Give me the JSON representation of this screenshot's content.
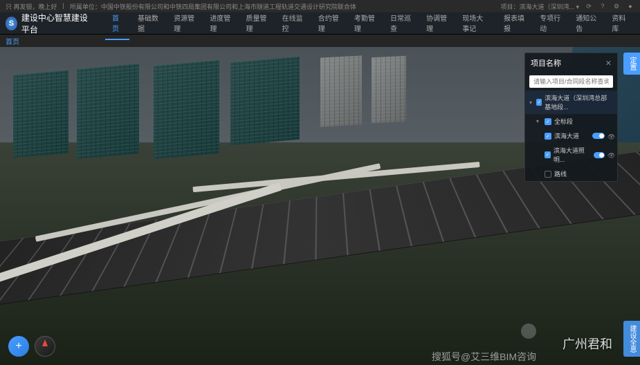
{
  "topBar": {
    "greeting": "只 再发银，晚上好",
    "org": "所属单位：中国中铁股份有限公司和中铁四局集团有限公司和上海市隧道工程轨道交通设计研究院联合体",
    "project": "项目：滨海大道（深圳湾...",
    "dropdown": "▾"
  },
  "app": {
    "logoText": "S",
    "title": "建设中心智慧建设平台"
  },
  "nav": {
    "items": [
      "首页",
      "基础数据",
      "资源管理",
      "进度管理",
      "质量管理",
      "在线监控",
      "合约管理",
      "考勤管理",
      "日常巡查",
      "协调管理",
      "现场大事记",
      "报表填报",
      "专项行动",
      "通知公告",
      "资料库"
    ],
    "activeIndex": 0
  },
  "breadcrumb": {
    "label": "首页"
  },
  "panel": {
    "title": "项目名称",
    "searchPlaceholder": "请输入项目/合同段名称查询",
    "mainProject": "滨海大道（深圳湾总部基地段...",
    "allLabel": "全标段",
    "items": [
      {
        "label": "滨海大道",
        "checked": true,
        "toggle": true
      },
      {
        "label": "滨海大道照明...",
        "checked": true,
        "toggle": true
      },
      {
        "label": "路线",
        "checked": false
      }
    ]
  },
  "sideTabs": {
    "top": "定置",
    "bottom": "建设全息"
  },
  "watermarks": {
    "main": "广州君和",
    "sub": "搜狐号@艾三维BIM咨询"
  }
}
